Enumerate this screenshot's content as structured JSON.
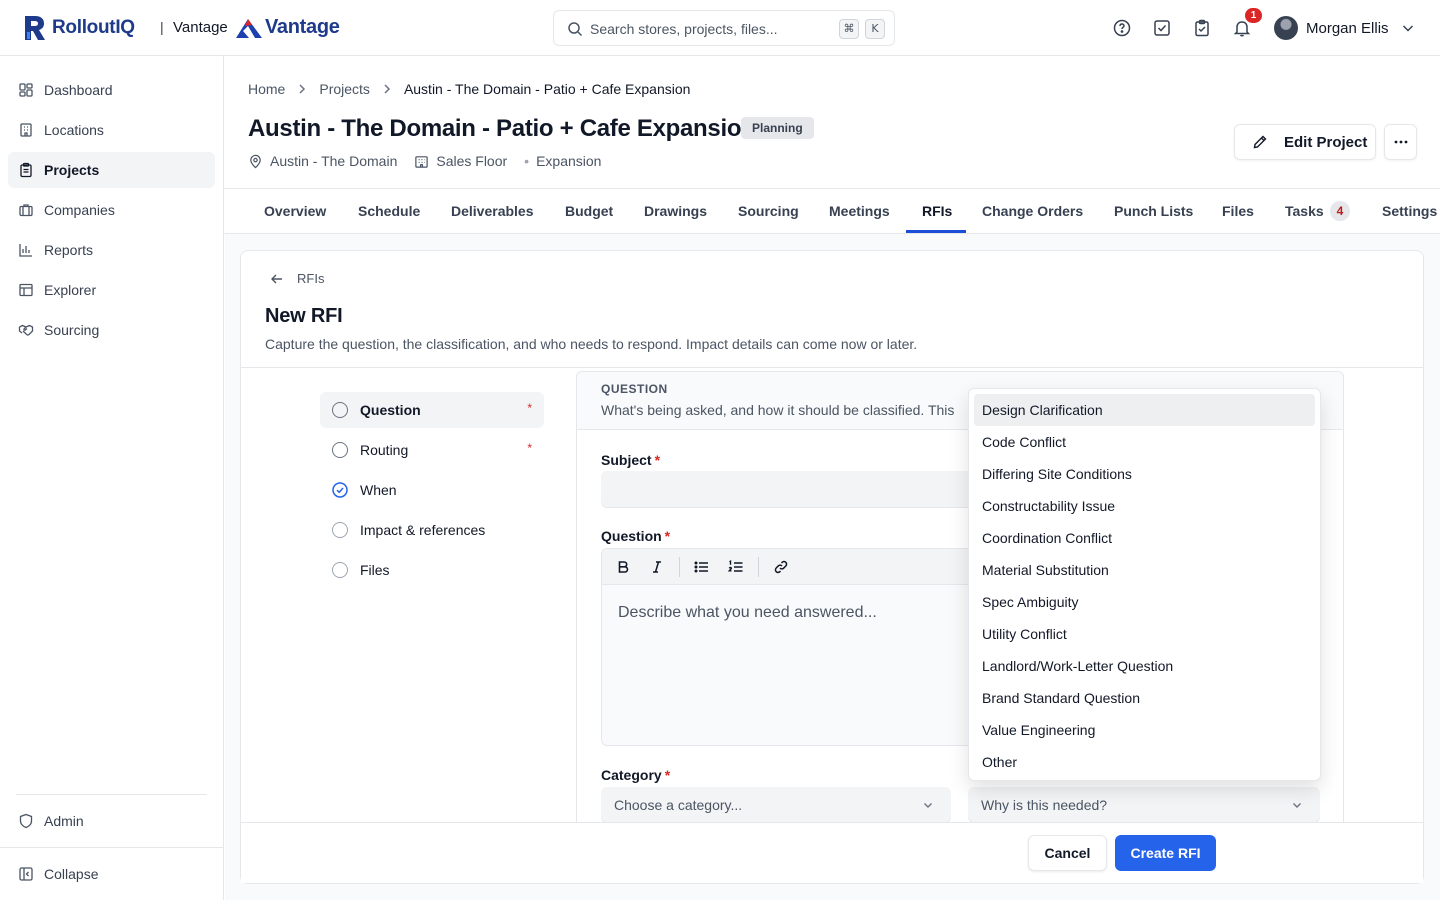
{
  "brand": {
    "name": "RolloutIQ",
    "separator": "|",
    "tenant": "Vantage",
    "tenant_logo_text": "Vantage"
  },
  "search": {
    "placeholder": "Search stores, projects, files...",
    "shortcut_mod": "⌘",
    "shortcut_key": "K"
  },
  "header": {
    "notification_count": "1",
    "user_name": "Morgan Ellis"
  },
  "sidebar": {
    "items": [
      {
        "label": "Dashboard",
        "icon": "dashboard-icon"
      },
      {
        "label": "Locations",
        "icon": "building-icon"
      },
      {
        "label": "Projects",
        "icon": "clipboard-icon",
        "active": true
      },
      {
        "label": "Companies",
        "icon": "briefcase-icon"
      },
      {
        "label": "Reports",
        "icon": "bar-chart-icon"
      },
      {
        "label": "Explorer",
        "icon": "table-icon"
      },
      {
        "label": "Sourcing",
        "icon": "handshake-icon"
      }
    ],
    "admin_label": "Admin",
    "collapse_label": "Collapse"
  },
  "breadcrumb": {
    "home": "Home",
    "projects": "Projects",
    "current": "Austin - The Domain - Patio + Cafe Expansion"
  },
  "project": {
    "title": "Austin - The Domain - Patio + Cafe Expansion",
    "status": "Planning",
    "location": "Austin - The Domain",
    "area": "Sales Floor",
    "type": "Expansion",
    "edit_label": "Edit Project"
  },
  "tabs": {
    "overview": "Overview",
    "schedule": "Schedule",
    "deliverables": "Deliverables",
    "budget": "Budget",
    "drawings": "Drawings",
    "sourcing": "Sourcing",
    "meetings": "Meetings",
    "rfis": "RFIs",
    "change_orders": "Change Orders",
    "punch_lists": "Punch Lists",
    "files": "Files",
    "tasks": "Tasks",
    "tasks_count": "4",
    "settings": "Settings",
    "active": "RFIs"
  },
  "form": {
    "back_label": "RFIs",
    "title": "New RFI",
    "subtitle": "Capture the question, the classification, and who needs to respond. Impact details can come now or later.",
    "steps": [
      {
        "label": "Question",
        "required": "*",
        "state": "current"
      },
      {
        "label": "Routing",
        "required": "*",
        "state": "incomplete"
      },
      {
        "label": "When",
        "required": "",
        "state": "complete"
      },
      {
        "label": "Impact & references",
        "required": "",
        "state": "incomplete"
      },
      {
        "label": "Files",
        "required": "",
        "state": "incomplete"
      }
    ],
    "section": {
      "label": "QUESTION",
      "description": "What's being asked, and how it should be classified. This"
    },
    "subject": {
      "label": "Subject",
      "required": "*",
      "value": ""
    },
    "question": {
      "label": "Question",
      "required": "*",
      "placeholder": "Describe what you need answered..."
    },
    "category": {
      "label": "Category",
      "required": "*",
      "placeholder": "Choose a category..."
    },
    "reason": {
      "placeholder": "Why is this needed?"
    },
    "cancel_label": "Cancel",
    "submit_label": "Create RFI"
  },
  "reason_dropdown": {
    "options": [
      "Design Clarification",
      "Code Conflict",
      "Differing Site Conditions",
      "Constructability Issue",
      "Coordination Conflict",
      "Material Substitution",
      "Spec Ambiguity",
      "Utility Conflict",
      "Landlord/Work-Letter Question",
      "Brand Standard Question",
      "Value Engineering",
      "Other"
    ],
    "highlighted": "Design Clarification"
  },
  "colors": {
    "accent": "#2563eb",
    "brand": "#1e3a8a",
    "required": "#dc2626"
  }
}
